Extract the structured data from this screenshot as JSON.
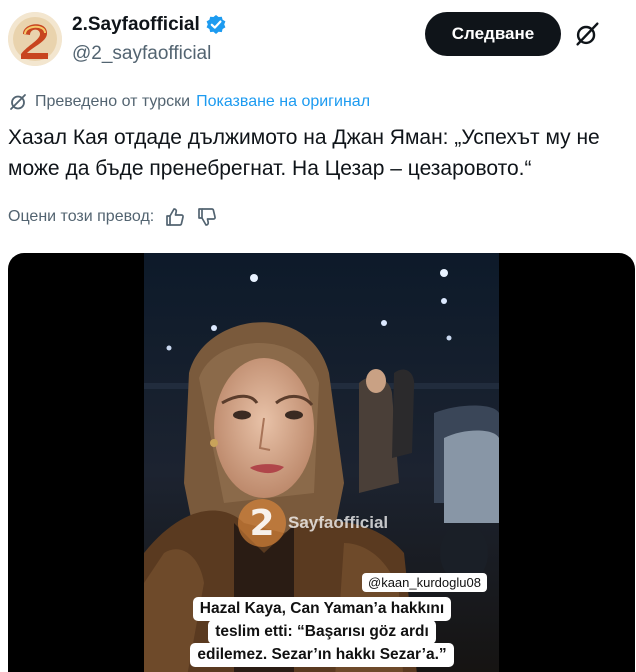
{
  "author": {
    "display_name": "2.Sayfaofficial",
    "handle": "@2_sayfaofficial",
    "verified": true,
    "avatar_icon": "logo-2-icon"
  },
  "actions": {
    "follow_label": "Следване",
    "grok_icon": "grok-icon"
  },
  "translation": {
    "label": "Преведено от турски",
    "show_original": "Показване на оригинал"
  },
  "tweet": {
    "text": "Хазал Кая отдаде дължимото на Джан Яман: „Успехът му не може да бъде пренебрегнат. На Цезар – цезаровото.“"
  },
  "rate": {
    "label": "Оцени този превод:",
    "like_icon": "thumbs-up-icon",
    "dislike_icon": "thumbs-down-icon"
  },
  "video": {
    "credit": "@kaan_kurdoglu08",
    "watermark_text": "Sayfaofficial",
    "watermark_logo": "2",
    "caption_lines": [
      "Hazal Kaya, Can Yaman’a hakkını",
      "teslim etti: “Başarısı göz ardı",
      "edilemez. Sezar’ın hakkı Sezar’a.”"
    ]
  },
  "colors": {
    "link": "#1d9bf0",
    "verified": "#1d9bf0",
    "follow_bg": "#0f1419",
    "secondary_text": "#536471"
  }
}
